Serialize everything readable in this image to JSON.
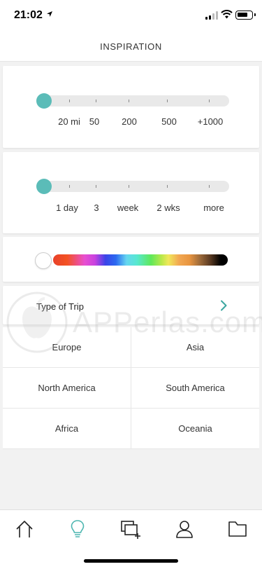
{
  "status_bar": {
    "time": "21:02"
  },
  "header": {
    "title": "INSPIRATION"
  },
  "distance_filter": {
    "labels": [
      "20 mi",
      "50",
      "200",
      "500",
      "+1000"
    ],
    "level": 0
  },
  "duration_filter": {
    "labels": [
      "1 day",
      "3",
      "week",
      "2 wks",
      "more"
    ],
    "level": 0
  },
  "color_filter": {
    "selected": "none"
  },
  "trip_type": {
    "label": "Type of Trip"
  },
  "regions": [
    "Europe",
    "Asia",
    "North America",
    "South America",
    "Africa",
    "Oceania"
  ],
  "watermark": {
    "text": "APPerlas.com"
  },
  "tab_bar": {
    "items": [
      "home-icon",
      "lightbulb-icon",
      "add-collection-icon",
      "profile-icon",
      "folder-icon"
    ],
    "active_index": 1
  },
  "colors": {
    "accent": "#5bbcb8",
    "active_tab": "#4db6b0",
    "chevron": "#3aa6a0"
  }
}
